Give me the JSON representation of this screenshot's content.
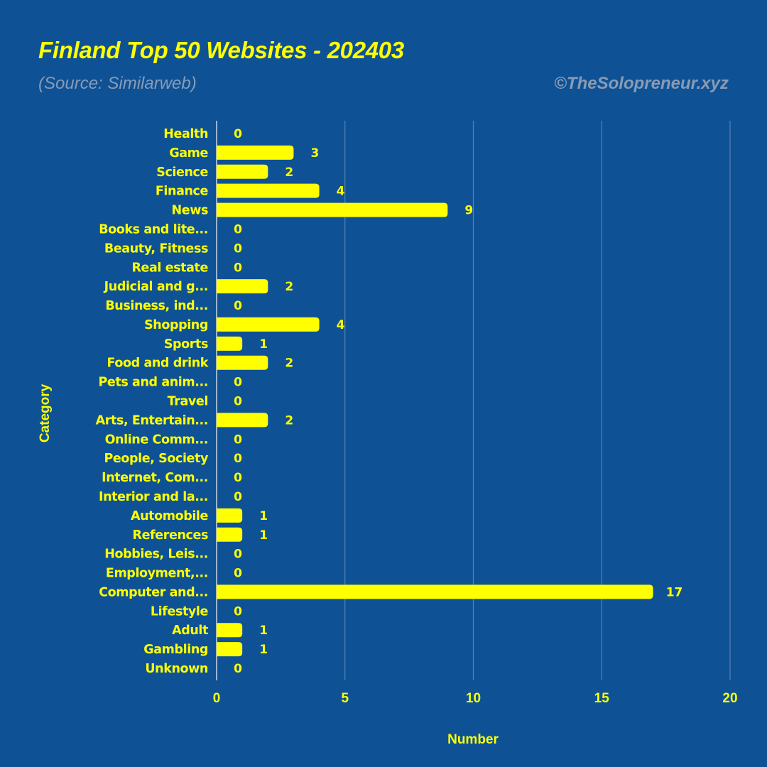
{
  "header": {
    "title": "Finland Top 50 Websites - 202403",
    "subtitle": "(Source: Similarweb)",
    "credit": "©TheSolopreneur.xyz"
  },
  "colors": {
    "background": "#0E5295",
    "bar": "#FFFF00",
    "text": "#FFFF00",
    "subtitle": "#8A9BB5",
    "grid": "#5A80B0"
  },
  "chart_data": {
    "type": "bar",
    "orientation": "horizontal",
    "title": "Finland Top 50 Websites - 202403",
    "subtitle": "(Source: Similarweb)",
    "xlabel": "Number",
    "ylabel": "Category",
    "xlim": [
      0,
      20
    ],
    "xticks": [
      0,
      5,
      10,
      15,
      20
    ],
    "grid": true,
    "categories": [
      "Health",
      "Game",
      "Science",
      "Finance",
      "News",
      "Books and lite...",
      "Beauty, Fitness",
      "Real estate",
      "Judicial and g...",
      "Business, ind...",
      "Shopping",
      "Sports",
      "Food and drink",
      "Pets and anim...",
      "Travel",
      "Arts, Entertain...",
      "Online Comm...",
      "People, Society",
      "Internet, Com...",
      "Interior and la...",
      "Automobile",
      "References",
      "Hobbies, Leis...",
      "Employment,...",
      "Computer and...",
      "Lifestyle",
      "Adult",
      "Gambling",
      "Unknown"
    ],
    "values": [
      0,
      3,
      2,
      4,
      9,
      0,
      0,
      0,
      2,
      0,
      4,
      1,
      2,
      0,
      0,
      2,
      0,
      0,
      0,
      0,
      1,
      1,
      0,
      0,
      17,
      0,
      1,
      1,
      0
    ]
  }
}
